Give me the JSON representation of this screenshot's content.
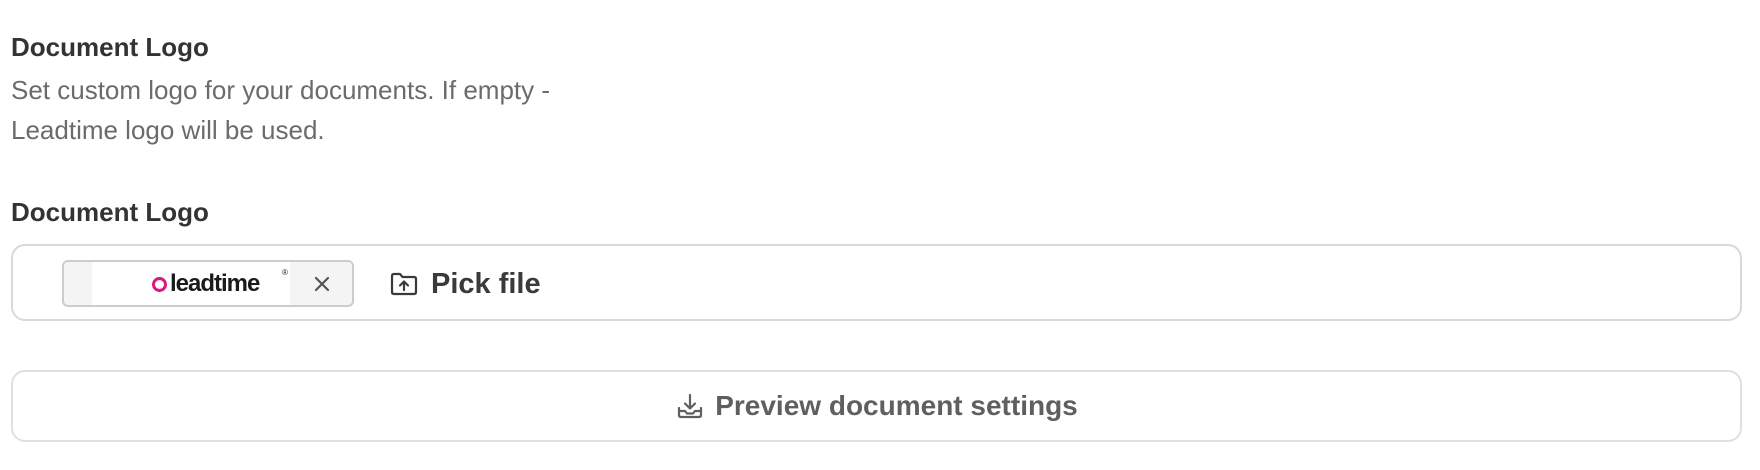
{
  "section": {
    "title": "Document Logo",
    "description": "Set custom logo for your documents. If empty - Leadtime logo will be used."
  },
  "field": {
    "label": "Document Logo",
    "file": {
      "logo_text": "leadtime",
      "logo_mark": "®",
      "logo_icon": "ring-icon",
      "remove_icon": "close-icon"
    },
    "pick_label": "Pick file",
    "pick_icon": "upload-folder-icon"
  },
  "preview": {
    "label": "Preview document settings",
    "icon": "download-tray-icon"
  },
  "colors": {
    "logo_accent": "#e0157f",
    "text_dark": "#333333",
    "text_muted": "#6b6b6b",
    "border": "#d9d9d9"
  }
}
